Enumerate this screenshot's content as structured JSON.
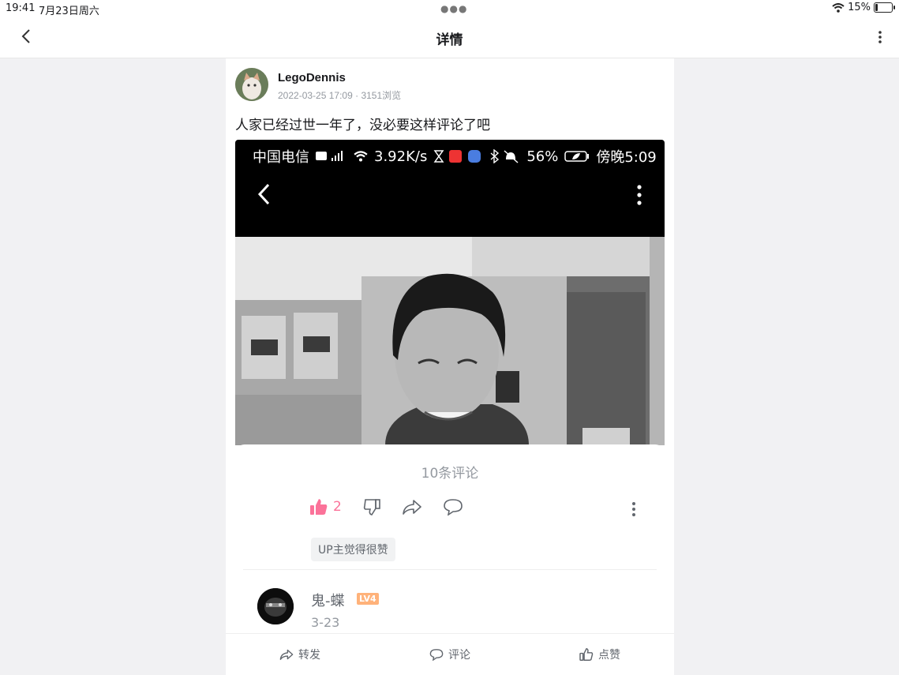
{
  "status_bar": {
    "time": "19:41",
    "date": "7月23日周六",
    "battery": "15%",
    "battery_level": 0.15
  },
  "nav": {
    "title": "详情"
  },
  "post": {
    "author": "LegoDennis",
    "timestamp": "2022-03-25 17:09",
    "views": "3151浏览",
    "text": "人家已经过世一年了，没必要这样评论了吧"
  },
  "screenshot": {
    "phone_status": {
      "carrier": "中国电信",
      "speed": "3.92K/s",
      "battery": "56%",
      "time": "傍晚5:09"
    },
    "comments_header": "10条评论",
    "like_count": "2",
    "up_badge": "UP主觉得很赞",
    "comment": {
      "username": "鬼-蝶",
      "level": "LV4",
      "date": "3-23"
    }
  },
  "bottom_bar": {
    "forward": "转发",
    "comment": "评论",
    "like": "点赞"
  },
  "icons": [
    "back-icon",
    "more-icon",
    "wifi-icon",
    "battery-icon",
    "thumb-up-icon",
    "thumb-down-icon",
    "share-icon",
    "comment-icon"
  ],
  "colors": {
    "accent_pink": "#fb7299",
    "level_badge": "#ffb27a",
    "muted_text": "#9499a0"
  }
}
